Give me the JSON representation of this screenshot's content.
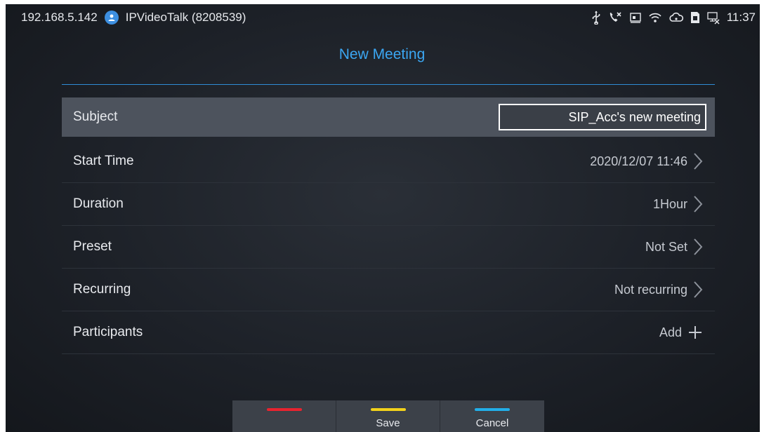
{
  "status_bar": {
    "ip_address": "192.168.5.142",
    "account_label": "IPVideoTalk (8208539)",
    "time": "11:37",
    "icons": [
      "usb-icon",
      "missed-call-icon",
      "screen-icon",
      "wifi-icon",
      "cloud-icon",
      "sim-icon",
      "network-off-icon"
    ]
  },
  "page": {
    "title": "New Meeting"
  },
  "form": {
    "subject": {
      "label": "Subject",
      "value": "SIP_Acc's new meeting"
    },
    "start_time": {
      "label": "Start Time",
      "value": "2020/12/07 11:46"
    },
    "duration": {
      "label": "Duration",
      "value": "1Hour"
    },
    "preset": {
      "label": "Preset",
      "value": "Not Set"
    },
    "recurring": {
      "label": "Recurring",
      "value": "Not recurring"
    },
    "participants": {
      "label": "Participants",
      "value": "Add"
    }
  },
  "softkeys": [
    {
      "label": "",
      "color": "#e8232f"
    },
    {
      "label": "Save",
      "color": "#f2d21b"
    },
    {
      "label": "Cancel",
      "color": "#22aee8"
    }
  ],
  "colors": {
    "accent": "#3ba6f2",
    "focused_row": "#4d535d"
  }
}
